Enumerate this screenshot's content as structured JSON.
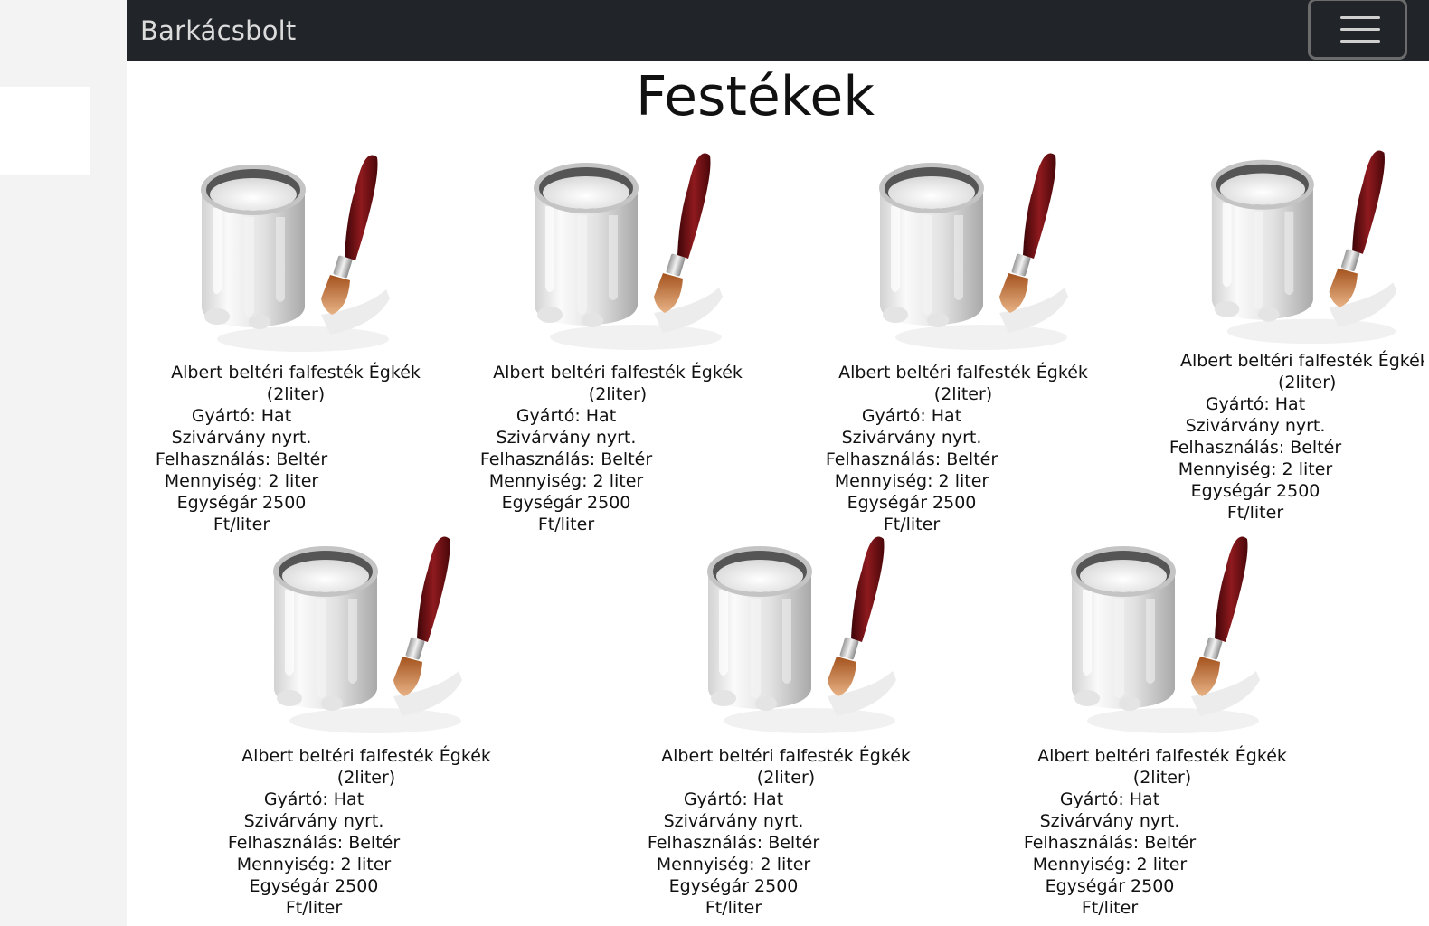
{
  "navbar": {
    "brand": "Barkácsbolt"
  },
  "page": {
    "title": "Festékek"
  },
  "products": [
    {
      "name": "Albert beltéri falfesték Égkék",
      "size": "(2liter)",
      "manufacturer": "Gyártó: Hat",
      "company": "Szivárvány nyrt.",
      "usage": "Felhasználás: Beltér",
      "quantity": "Mennyiség: 2 liter",
      "price": "Egységár 2500",
      "unit": "Ft/liter",
      "image": "paint-bucket-with-brush"
    },
    {
      "name": "Albert beltéri falfesték Égkék",
      "size": "(2liter)",
      "manufacturer": "Gyártó: Hat",
      "company": "Szivárvány nyrt.",
      "usage": "Felhasználás: Beltér",
      "quantity": "Mennyiség: 2 liter",
      "price": "Egységár 2500",
      "unit": "Ft/liter",
      "image": "paint-bucket-with-brush"
    },
    {
      "name": "Albert beltéri falfesték Égkék",
      "size": "(2liter)",
      "manufacturer": "Gyártó: Hat",
      "company": "Szivárvány nyrt.",
      "usage": "Felhasználás: Beltér",
      "quantity": "Mennyiség: 2 liter",
      "price": "Egységár 2500",
      "unit": "Ft/liter",
      "image": "paint-bucket-with-brush"
    },
    {
      "name": "Albert beltéri falfesték Égkék",
      "size": "(2liter)",
      "manufacturer": "Gyártó: Hat",
      "company": "Szivárvány nyrt.",
      "usage": "Felhasználás: Beltér",
      "quantity": "Mennyiség: 2 liter",
      "price": "Egységár 2500",
      "unit": "Ft/liter",
      "image": "paint-bucket-with-brush"
    },
    {
      "name": "Albert beltéri falfesték Égkék",
      "size": "(2liter)",
      "manufacturer": "Gyártó: Hat",
      "company": "Szivárvány nyrt.",
      "usage": "Felhasználás: Beltér",
      "quantity": "Mennyiség: 2 liter",
      "price": "Egységár 2500",
      "unit": "Ft/liter",
      "image": "paint-bucket-with-brush"
    },
    {
      "name": "Albert beltéri falfesték Égkék",
      "size": "(2liter)",
      "manufacturer": "Gyártó: Hat",
      "company": "Szivárvány nyrt.",
      "usage": "Felhasználás: Beltér",
      "quantity": "Mennyiség: 2 liter",
      "price": "Egységár 2500",
      "unit": "Ft/liter",
      "image": "paint-bucket-with-brush"
    },
    {
      "name": "Albert beltéri falfesték Égkék",
      "size": "(2liter)",
      "manufacturer": "Gyártó: Hat",
      "company": "Szivárvány nyrt.",
      "usage": "Felhasználás: Beltér",
      "quantity": "Mennyiség: 2 liter",
      "price": "Egységár 2500",
      "unit": "Ft/liter",
      "image": "paint-bucket-with-brush"
    }
  ],
  "colors": {
    "navbar_bg": "#212529",
    "brand_text": "#dcdcdc",
    "brush_handle": "#6b0f12",
    "bristles": "#c77a3a"
  }
}
